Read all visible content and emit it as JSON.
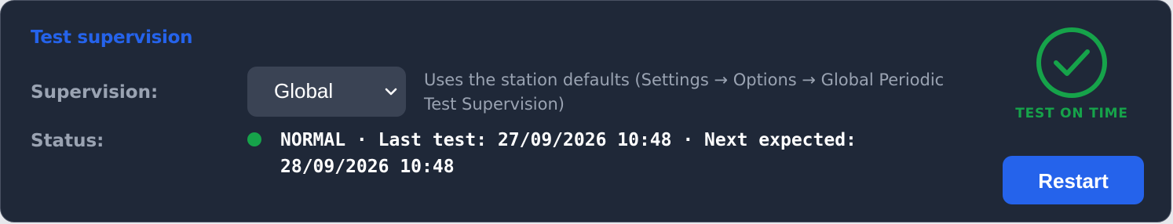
{
  "section": {
    "title": "Test supervision"
  },
  "supervision": {
    "label": "Supervision:",
    "selected": "Global",
    "hint": "Uses the station defaults (Settings → Options → Global Periodic Test Supervision)"
  },
  "status": {
    "label": "Status:",
    "text": "NORMAL · Last test: 27/09/2026 10:48 · Next expected: 28/09/2026 10:48",
    "dot_color": "#16a34a"
  },
  "badge": {
    "icon": "check-circle-icon",
    "text": "TEST ON TIME",
    "color": "#16a34a"
  },
  "actions": {
    "restart_label": "Restart"
  },
  "colors": {
    "accent": "#2563eb",
    "background": "#1f2838",
    "success": "#16a34a"
  }
}
